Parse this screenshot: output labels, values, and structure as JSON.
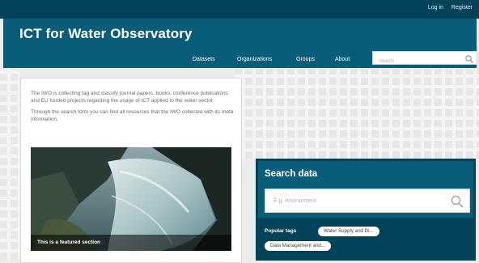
{
  "header": {
    "account_links": [
      "Log in",
      "Register"
    ],
    "site_title": "ICT for Water Observatory",
    "nav": [
      "Datasets",
      "Organizations",
      "Groups",
      "About"
    ],
    "search_placeholder": "Search"
  },
  "intro": {
    "paragraphs": [
      "The IWO is collecting tag and classify journal papers, books, conference publications and EU funded projects regarding the usage of ICT applied to the water sector.",
      "Through the search form you can find all resources that the IWO collected with its meta information."
    ],
    "featured_caption": "This is a featured section"
  },
  "search_data": {
    "title": "Search data",
    "placeholder": "E.g. environment",
    "popular_tags_label": "Popular tags",
    "tags": [
      "Water Supply and Di...",
      "Data Management and..."
    ]
  },
  "colors": {
    "topbar": "#02435a",
    "masthead": "#0a5d78",
    "search_panel": "#0a5d78"
  }
}
